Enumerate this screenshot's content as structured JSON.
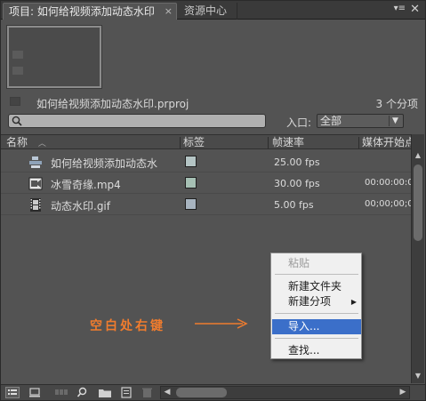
{
  "tabs": {
    "project_tab": "项目: 如何给视频添加动态水印",
    "resources_tab": "资源中心",
    "close_glyph": "×",
    "menu_glyph": "▾≡",
    "panel_close_glyph": "✕"
  },
  "project": {
    "file_name": "如何给视频添加动态水印.prproj",
    "item_count": "3 个分项"
  },
  "search": {
    "placeholder": "",
    "in_label": "入口:",
    "in_value": "全部"
  },
  "columns": {
    "name": "名称",
    "label": "标签",
    "frame_rate": "帧速率",
    "media_start": "媒体开始点"
  },
  "rows": [
    {
      "icon": "sequence-icon",
      "name": "如何给视频添加动态水",
      "label_color": "#b4c4c4",
      "fps": "25.00 fps",
      "start": ""
    },
    {
      "icon": "video-file-icon",
      "name": "冰雪奇缘.mp4",
      "label_color": "#a6c0b4",
      "fps": "30.00 fps",
      "start": "00:00:00:00"
    },
    {
      "icon": "film-clip-icon",
      "name": "动态水印.gif",
      "label_color": "#a8b4c0",
      "fps": "5.00 fps",
      "start": "00;00;00;00"
    }
  ],
  "context_menu": {
    "paste": "粘贴",
    "new_bin": "新建文件夹",
    "new_item": "新建分项",
    "import": "导入...",
    "find": "查找..."
  },
  "annotation": "空白处右键",
  "colors": {
    "panel_bg": "#535353",
    "menu_highlight": "#3b6fc9",
    "annotation": "#f07c2e"
  }
}
